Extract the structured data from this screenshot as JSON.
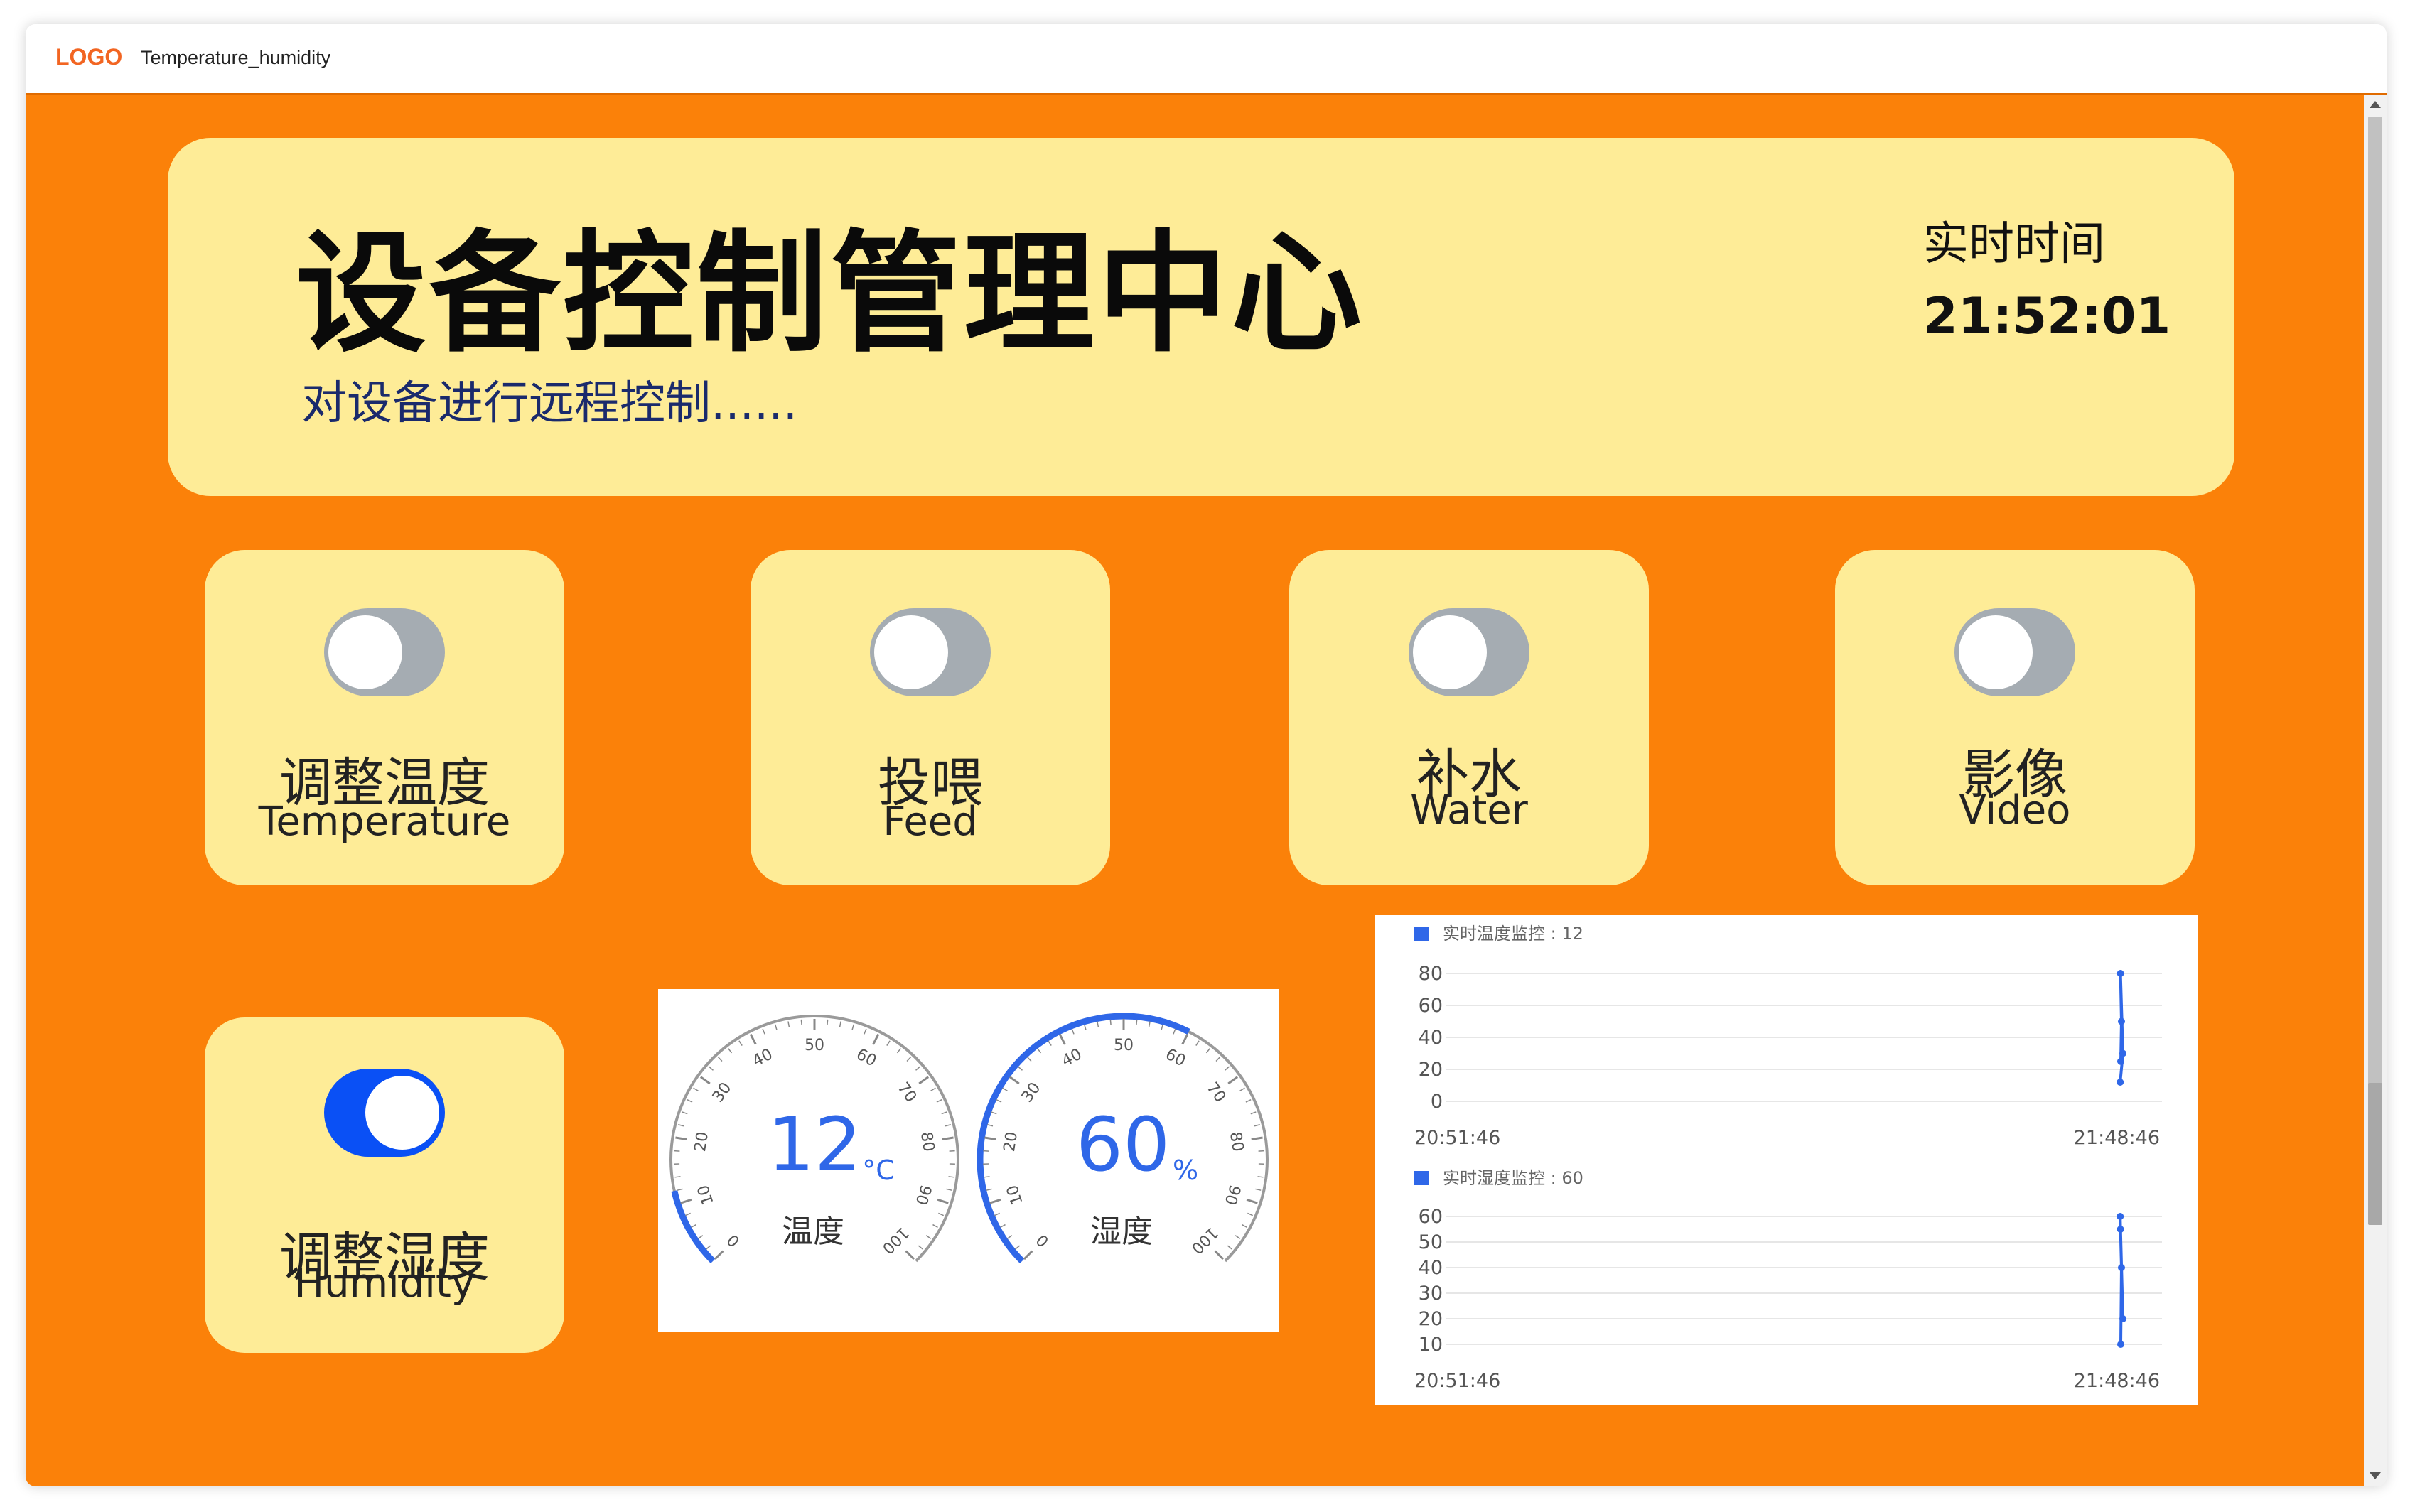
{
  "window": {
    "logo": "LOGO",
    "title": "Temperature_humidity"
  },
  "header": {
    "title": "设备控制管理中心",
    "subtitle": "对设备进行远程控制......",
    "time_label": "实时时间",
    "time_value": "21:52:01"
  },
  "controls": [
    {
      "cn": "调整温度",
      "en": "Temperature",
      "on": false
    },
    {
      "cn": "投喂",
      "en": "Feed",
      "on": false
    },
    {
      "cn": "补水",
      "en": "Water",
      "on": false
    },
    {
      "cn": "影像",
      "en": "Video",
      "on": false
    },
    {
      "cn": "调整湿度",
      "en": "Humidity",
      "on": true
    }
  ],
  "gauges": [
    {
      "value": "12",
      "unit": "°C",
      "label": "温度",
      "ticks": [
        "0",
        "10",
        "20",
        "30",
        "40",
        "50",
        "60",
        "70",
        "80",
        "90",
        "100"
      ]
    },
    {
      "value": "60",
      "unit": "%",
      "label": "湿度",
      "ticks": [
        "0",
        "10",
        "20",
        "30",
        "40",
        "50",
        "60",
        "70",
        "80",
        "90",
        "100"
      ]
    }
  ],
  "chart_data": [
    {
      "type": "line",
      "title": "实时温度监控 : 12",
      "series": [
        {
          "name": "实时温度监控 : 12",
          "values": [
            25,
            50,
            80,
            30,
            12
          ]
        }
      ],
      "x_tick_labels": [
        "20:51:46",
        "21:48:46"
      ],
      "y_ticks": [
        "0",
        "20",
        "40",
        "60",
        "80"
      ],
      "ylim": [
        0,
        80
      ],
      "color": "#2f67e8"
    },
    {
      "type": "line",
      "title": "实时湿度监控 : 60",
      "series": [
        {
          "name": "实时湿度监控 : 60",
          "values": [
            10,
            40,
            55,
            20,
            60
          ]
        }
      ],
      "x_tick_labels": [
        "20:51:46",
        "21:48:46"
      ],
      "y_ticks": [
        "10",
        "20",
        "30",
        "40",
        "50",
        "60"
      ],
      "ylim": [
        10,
        60
      ],
      "color": "#2f67e8"
    }
  ]
}
